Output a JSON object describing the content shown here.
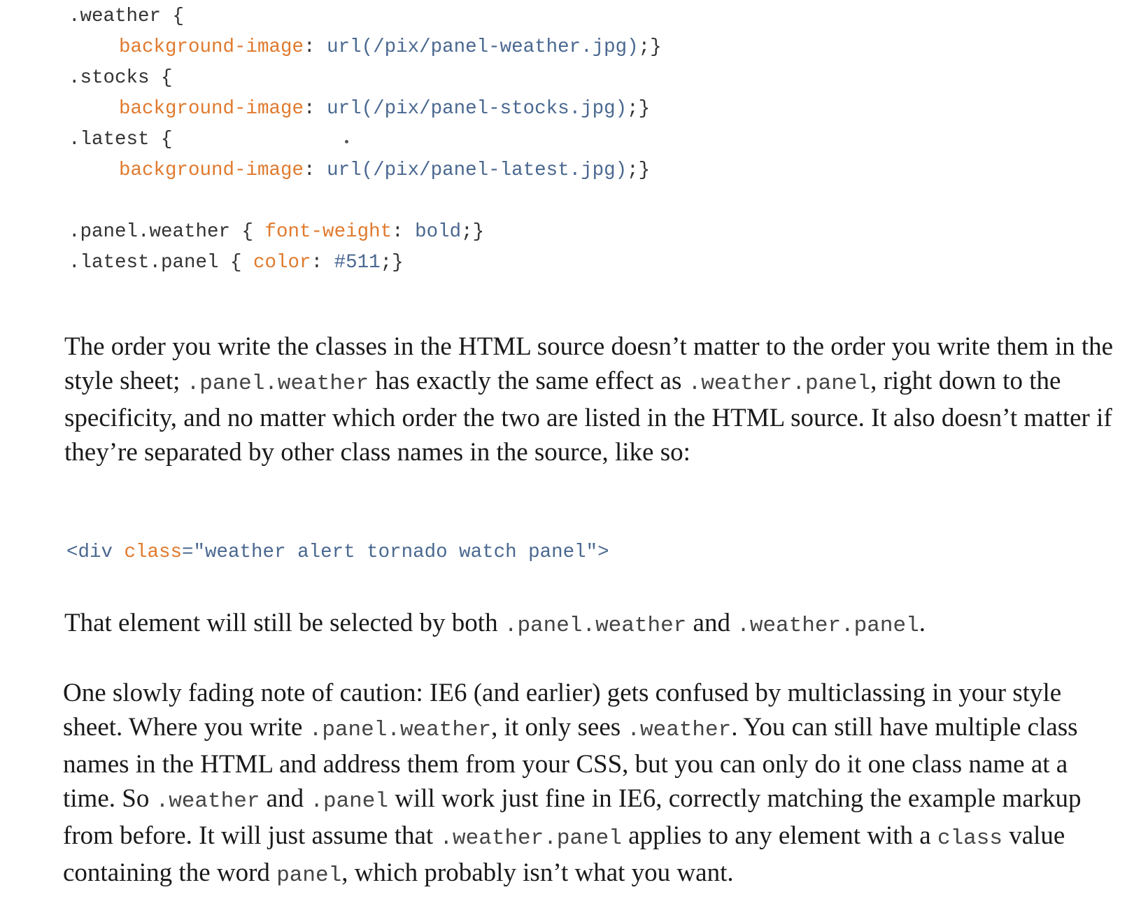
{
  "code_block_1": {
    "lines": [
      {
        "sel": ".weather {"
      },
      {
        "prop": "background-image",
        "colon": ":",
        "val": " url(/pix/panel-weather.jpg)",
        "end": ";}"
      },
      {
        "sel": ".stocks {"
      },
      {
        "prop": "background-image",
        "colon": ":",
        "val": " url(/pix/panel-stocks.jpg)",
        "end": ";}"
      },
      {
        "sel": ".latest {"
      },
      {
        "prop": "background-image",
        "colon": ":",
        "val": " url(/pix/panel-latest.jpg)",
        "end": ";}"
      },
      {
        "sel": ""
      },
      {
        "sel": ".panel.weather { ",
        "prop": "font-weight",
        "colon": ":",
        "val": " bold",
        "end": ";}"
      },
      {
        "sel": ".latest.panel { ",
        "prop": "color",
        "colon": ":",
        "val": " #511",
        "end": ";}"
      }
    ]
  },
  "paragraph_1": {
    "t1": "The order you write the classes in the HTML source doesn’t matter to the order you write them in the style sheet; ",
    "c1": ".panel.weather",
    "t2": " has exactly the same effect as ",
    "c2": ".weather.panel",
    "t3": ", right down to the specificity, and no matter which order the two are listed in the HTML source. It also doesn’t matter if they’re separated by other class names in the source, like so:"
  },
  "code_block_2": {
    "open": "<div ",
    "attr": "class",
    "eq": "=\"",
    "value": "weather alert tornado watch panel",
    "close": "\">"
  },
  "paragraph_2": {
    "t1": "That element will still be selected by both ",
    "c1": ".panel.weather",
    "t2": " and ",
    "c2": ".weather.panel",
    "t3": "."
  },
  "paragraph_3": {
    "t1": "One slowly fading note of caution: IE6 (and earlier) gets confused by multiclassing in your style sheet. Where you write ",
    "c1": ".panel.weather",
    "t2": ", it only sees ",
    "c2": ".weather",
    "t3": ". You can still have multiple class names in the HTML and address them from your CSS, but you can only do it one class name at a time. So ",
    "c3": ".weather",
    "t4": " and ",
    "c4": ".panel",
    "t5": " will work just fine in IE6, correctly matching the example markup from before. It will just assume that ",
    "c5": ".weather.panel",
    "t6": " applies to any element with a ",
    "c6": "class",
    "t7": " value containing the word ",
    "c7": "panel",
    "t8": ", which probably isn’t what you want."
  }
}
